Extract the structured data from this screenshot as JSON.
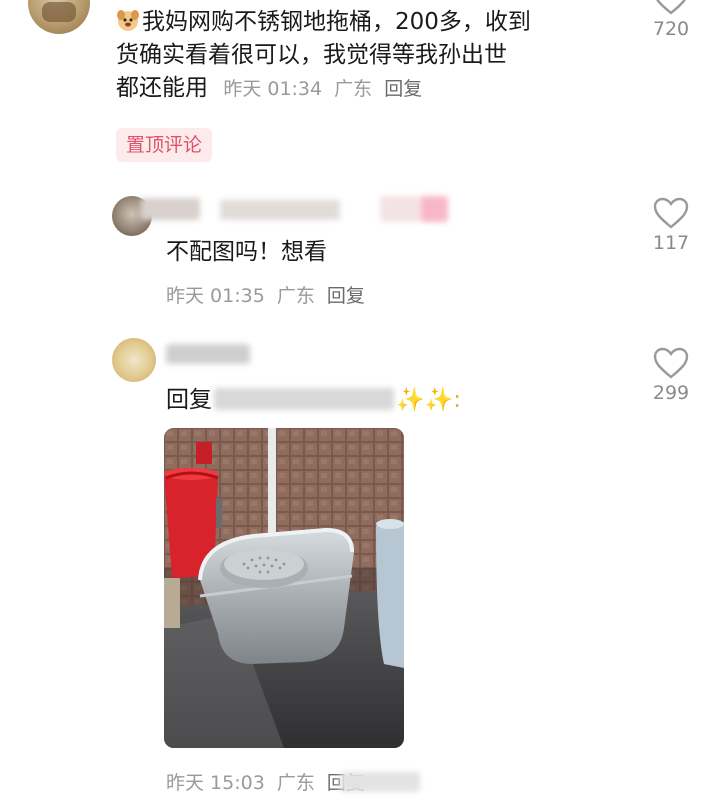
{
  "comments": [
    {
      "text_lines": [
        "我妈网购不锈钢地拖桶，200多，收到",
        "货确实看着很可以，我觉得等我孙出世",
        "都还能用"
      ],
      "time": "昨天 01:34",
      "location": "广东",
      "reply_label": "回复",
      "badge": "置顶评论",
      "likes": "720"
    },
    {
      "text": "不配图吗！想看",
      "time": "昨天 01:35",
      "location": "广东",
      "reply_label": "回复",
      "likes": "117"
    },
    {
      "text_prefix": "回复",
      "text_suffix": "✨✨:",
      "time": "昨天 15:03",
      "location": "广东",
      "reply_label": "回复",
      "likes": "299"
    }
  ],
  "colors": {
    "badge_bg": "#fdebec",
    "badge_text": "#e1506a",
    "meta_text": "#9a9a9a"
  }
}
